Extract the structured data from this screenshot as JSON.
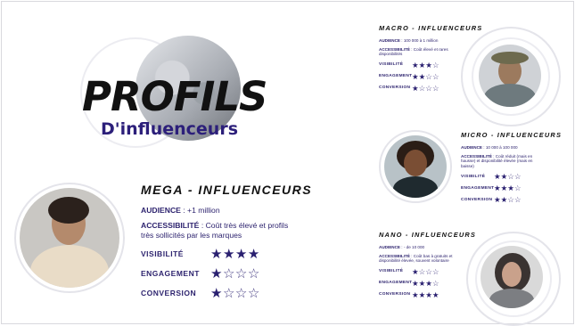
{
  "title": {
    "main": "PROFILS",
    "sub": "D'influenceurs"
  },
  "colors": {
    "accent": "#2e246f",
    "title": "#111111",
    "ring": "#e4e4ea"
  },
  "icons": {
    "filled_star": "star-filled-icon",
    "empty_star": "star-outline-icon"
  },
  "mega": {
    "title": "MEGA - INFLUENCEURS",
    "audience_label": "AUDIENCE",
    "audience": ": +1 million",
    "accessibility_label": "ACCESSIBILITÉ",
    "accessibility": ": Coût très élevé et profils très sollicités par les marques",
    "ratings": [
      {
        "label": "VISIBILITÉ",
        "stars": 4
      },
      {
        "label": "ENGAGEMENT",
        "stars": 1
      },
      {
        "label": "CONVERSION",
        "stars": 1
      }
    ]
  },
  "macro": {
    "title": "MACRO - INFLUENCEURS",
    "audience_label": "AUDIENCE",
    "audience": ": 100 000 à 1 million",
    "accessibility_label": "ACCESSIBILITÉ",
    "accessibility": ": Coût élevé et rares disponibilités",
    "ratings": [
      {
        "label": "VISIBILITÉ",
        "stars": 3
      },
      {
        "label": "ENGAGEMENT",
        "stars": 2
      },
      {
        "label": "CONVERSION",
        "stars": 1
      }
    ]
  },
  "micro": {
    "title": "MICRO - INFLUENCEURS",
    "audience_label": "AUDIENCE",
    "audience": ": 10 000 à 100 000",
    "accessibility_label": "ACCESSIBILITÉ",
    "accessibility": ": Coût réduit (mais en hausse) et disponibilité élevée (mais en baisse)",
    "ratings": [
      {
        "label": "VISIBILITÉ",
        "stars": 2
      },
      {
        "label": "ENGAGEMENT",
        "stars": 3
      },
      {
        "label": "CONVERSION",
        "stars": 2
      }
    ]
  },
  "nano": {
    "title": "NANO - INFLUENCEURS",
    "audience_label": "AUDIENCE",
    "audience": ": - de 10 000",
    "accessibility_label": "ACCESSIBILITÉ",
    "accessibility": ": Coût bas à gratuits et disponibilité élevée, souvent volontaire",
    "ratings": [
      {
        "label": "VISIBILITÉ",
        "stars": 1
      },
      {
        "label": "ENGAGEMENT",
        "stars": 3
      },
      {
        "label": "CONVERSION",
        "stars": 4
      }
    ]
  }
}
